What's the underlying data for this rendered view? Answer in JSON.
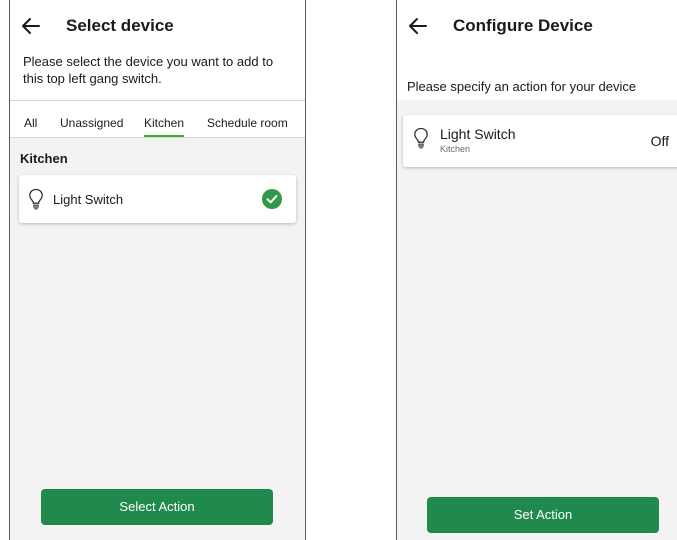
{
  "left_screen": {
    "title": "Select device",
    "prompt": "Please select the device you want to add to this top left gang switch.",
    "tabs": [
      {
        "label": "All",
        "active": false
      },
      {
        "label": "Unassigned",
        "active": false
      },
      {
        "label": "Kitchen",
        "active": true
      },
      {
        "label": "Schedule room",
        "active": false
      }
    ],
    "section_title": "Kitchen",
    "device": {
      "name": "Light Switch",
      "selected": true
    },
    "button_label": "Select Action"
  },
  "right_screen": {
    "title": "Configure Device",
    "prompt": "Please specify an action for your device",
    "device": {
      "name": "Light Switch",
      "room": "Kitchen",
      "state": "Off"
    },
    "button_label": "Set Action"
  },
  "colors": {
    "accent_green": "#1f8a4c",
    "tab_underline": "#3dae2b",
    "check_green": "#2e9a4a"
  },
  "icons": [
    "back-arrow-icon",
    "light-bulb-icon",
    "check-circle-icon"
  ]
}
